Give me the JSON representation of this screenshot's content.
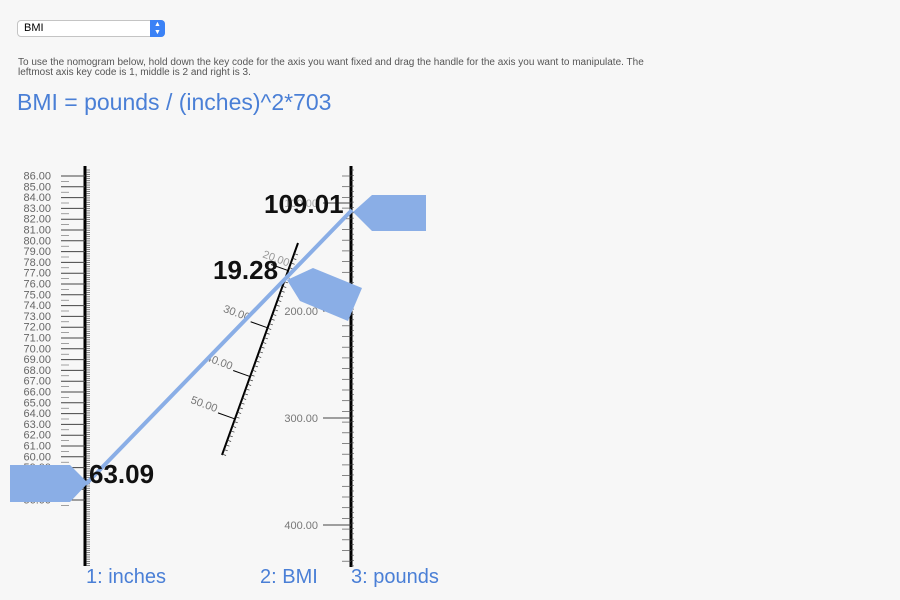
{
  "selector": {
    "value": "BMI"
  },
  "instructions": "To use the nomogram below, hold down the key code for the axis you want fixed and drag the handle for the axis you want to manipulate. The leftmost axis key code is 1, middle is 2 and right is 3.",
  "formula": "BMI = pounds / (inches)^2*703",
  "colors": {
    "accent": "#4a7fd6",
    "handle": "#8aaee6",
    "line": "#8aaee6"
  },
  "axes": {
    "inches": {
      "label": "1: inches",
      "ticks": [
        "86.00",
        "85.00",
        "84.00",
        "83.00",
        "82.00",
        "81.00",
        "80.00",
        "79.00",
        "78.00",
        "77.00",
        "76.00",
        "75.00",
        "74.00",
        "73.00",
        "72.00",
        "71.00",
        "70.00",
        "69.00",
        "68.00",
        "67.00",
        "66.00",
        "65.00",
        "64.00",
        "63.00",
        "62.00",
        "61.00",
        "60.00",
        "59.00",
        "58.00",
        "57.00",
        "56.00"
      ],
      "value": "63.09"
    },
    "bmi": {
      "label": "2: BMI",
      "ticks": [
        "20.00",
        "30.00",
        "40.00",
        "50.00"
      ],
      "value": "19.28"
    },
    "pounds": {
      "label": "3: pounds",
      "ticks": [
        "100.00",
        "200.00",
        "300.00",
        "400.00"
      ],
      "value": "109.01"
    }
  }
}
